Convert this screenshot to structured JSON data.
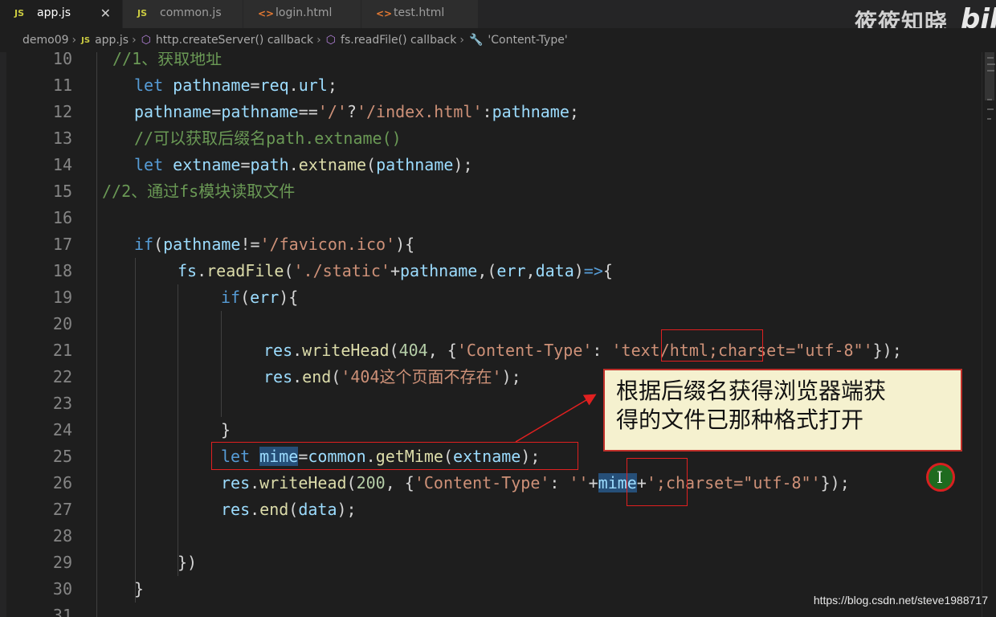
{
  "tabs": [
    {
      "label": "app.js",
      "icon": "JS",
      "active": true,
      "close": "✕"
    },
    {
      "label": "common.js",
      "icon": "JS",
      "active": false
    },
    {
      "label": "login.html",
      "icon": "<>",
      "active": false
    },
    {
      "label": "test.html",
      "icon": "<>",
      "active": false
    }
  ],
  "watermark": {
    "logo": "筱筱知晓",
    "bili": "bili"
  },
  "breadcrumb": {
    "items": [
      "demo09",
      "app.js",
      "http.createServer() callback",
      "fs.readFile() callback",
      "'Content-Type'"
    ],
    "js_icon": "JS"
  },
  "line_numbers": [
    "10",
    "11",
    "12",
    "13",
    "14",
    "15",
    "16",
    "17",
    "18",
    "19",
    "20",
    "21",
    "22",
    "23",
    "24",
    "25",
    "26",
    "27",
    "28",
    "29",
    "30",
    "31"
  ],
  "code": {
    "l10": "//1、获取地址",
    "l11": [
      "let",
      "pathname",
      "=",
      "req",
      ".",
      "url",
      ";"
    ],
    "l12": [
      "pathname",
      "=",
      "pathname",
      "==",
      "'/'",
      "?",
      "'/index.html'",
      ":",
      "pathname",
      ";"
    ],
    "l13": "//可以获取后缀名path.extname()",
    "l14": [
      "let",
      "extname",
      "=",
      "path",
      ".",
      "extname",
      "(",
      "pathname",
      ");"
    ],
    "l15": "//2、通过fs模块读取文件",
    "l17": [
      "if",
      "(",
      "pathname",
      "!=",
      "'/favicon.ico'",
      "){"
    ],
    "l18": [
      "fs",
      ".",
      "readFile",
      "(",
      "'./static'",
      "+",
      "pathname",
      ",(",
      "err",
      ",",
      "data",
      ")",
      "=>",
      "{"
    ],
    "l19": [
      "if",
      "(",
      "err",
      "){"
    ],
    "l21": [
      "res",
      ".",
      "writeHead",
      "(",
      "404",
      ", {",
      "'Content-Type'",
      ": ",
      "'text/html;charset=\"utf-8\"'",
      "});"
    ],
    "l22": [
      "res",
      ".",
      "end",
      "(",
      "'404这个页面不存在'",
      ");"
    ],
    "l24": "}",
    "l25": [
      "let",
      "mime",
      "=",
      "common",
      ".",
      "getMime",
      "(",
      "extname",
      ");"
    ],
    "l26": [
      "res",
      ".",
      "writeHead",
      "(",
      "200",
      ", {",
      "'Content-Type'",
      ": ",
      "''",
      "+",
      "mime",
      "+",
      "';charset=\"utf-8\"'",
      "});"
    ],
    "l27": [
      "res",
      ".",
      "end",
      "(",
      "data",
      ");"
    ],
    "l29": "})",
    "l30": "}"
  },
  "callout": {
    "line1": "根据后缀名获得浏览器端获",
    "line2": "得的文件已那种格式打开"
  },
  "url_watermark": "https://blog.csdn.net/steve1988717",
  "cursor_glyph": "I",
  "colors": {
    "keyword": "#569cd6",
    "variable": "#9cdcfe",
    "function": "#dcdcaa",
    "string": "#ce9178",
    "number": "#b5cea8",
    "comment": "#6a9955",
    "annotation_red": "#e02020",
    "callout_bg": "#f5f1cf"
  }
}
